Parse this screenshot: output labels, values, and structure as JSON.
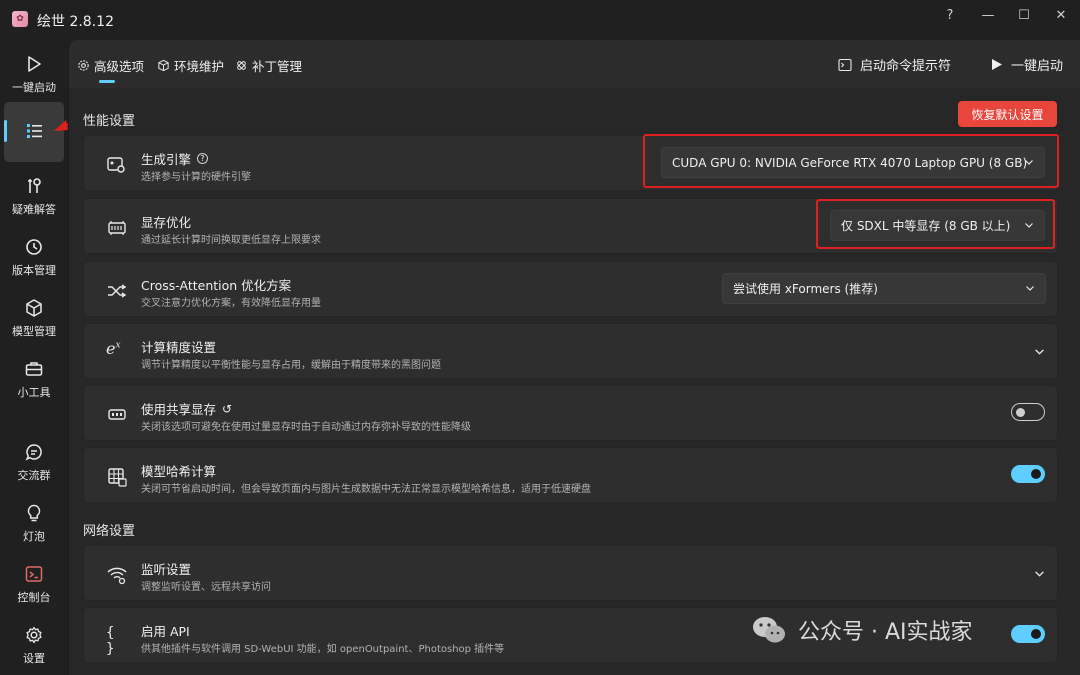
{
  "app": {
    "title": "绘世 2.8.12"
  },
  "window": {
    "help": "?",
    "minimize": "—",
    "maximize": "☐",
    "close": "✕"
  },
  "sidebar": {
    "items": [
      {
        "label": "一键启动",
        "icon": "play-icon"
      },
      {
        "label": "",
        "icon": "list-icon",
        "active": true
      },
      {
        "label": "疑难解答",
        "icon": "tools-icon"
      },
      {
        "label": "版本管理",
        "icon": "history-icon"
      },
      {
        "label": "模型管理",
        "icon": "cube-icon"
      },
      {
        "label": "小工具",
        "icon": "toolbox-icon"
      },
      {
        "label": "交流群",
        "icon": "chat-icon"
      },
      {
        "label": "灯泡",
        "icon": "bulb-icon"
      },
      {
        "label": "控制台",
        "icon": "console-icon"
      },
      {
        "label": "设置",
        "icon": "gear-icon"
      }
    ]
  },
  "topnav": {
    "tabs": [
      {
        "label": "高级选项",
        "icon": "gear-icon",
        "active": true
      },
      {
        "label": "环境维护",
        "icon": "cube-icon"
      },
      {
        "label": "补丁管理",
        "icon": "patch-icon"
      }
    ],
    "cmd_label": "启动命令提示符",
    "launch_label": "一键启动"
  },
  "performance": {
    "section_title": "性能设置",
    "reset_label": "恢复默认设置",
    "engine": {
      "title": "生成引擎",
      "desc": "选择参与计算的硬件引擎",
      "value": "CUDA GPU 0: NVIDIA GeForce RTX 4070 Laptop GPU (8 GB)"
    },
    "vram": {
      "title": "显存优化",
      "desc": "通过延长计算时间换取更低显存上限要求",
      "value": "仅 SDXL 中等显存 (8 GB 以上)"
    },
    "attention": {
      "title": "Cross-Attention 优化方案",
      "desc": "交叉注意力优化方案，有效降低显存用量",
      "value": "尝试使用 xFormers (推荐)"
    },
    "precision": {
      "title": "计算精度设置",
      "desc": "调节计算精度以平衡性能与显存占用，缓解由于精度带来的黑图问题"
    },
    "shared_vram": {
      "title": "使用共享显存",
      "desc": "关闭该选项可避免在使用过量显存时由于自动通过内存弥补导致的性能降级",
      "enabled": false
    },
    "model_hash": {
      "title": "模型哈希计算",
      "desc": "关闭可节省启动时间，但会导致页面内与图片生成数据中无法正常显示模型哈希信息，适用于低速硬盘",
      "enabled": true
    }
  },
  "network": {
    "section_title": "网络设置",
    "listen": {
      "title": "监听设置",
      "desc": "调整监听设置、远程共享访问"
    },
    "api": {
      "title": "启用 API",
      "desc": "供其他插件与软件调用 SD-WebUI 功能，如 openOutpaint、Photoshop 插件等",
      "enabled": true
    }
  },
  "watermark": {
    "text": "公众号 · AI实战家"
  },
  "colors": {
    "accent": "#60cdff",
    "reset": "#e8453c",
    "highlight": "#e02020"
  }
}
